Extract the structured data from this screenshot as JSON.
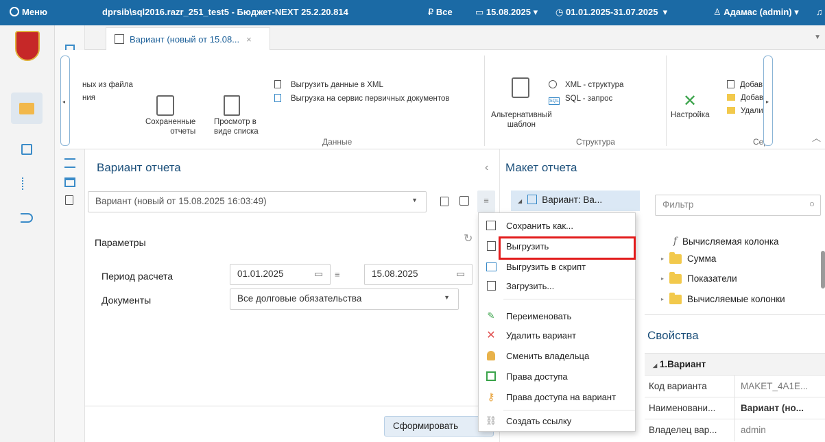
{
  "topbar": {
    "menu_label": "Меню",
    "window_title": "dprsib\\sql2016.razr_251_test5 - Бюджет-NEXT 25.2.20.814",
    "currency_filter": "Все",
    "date": "15.08.2025",
    "period": "01.01.2025-31.07.2025",
    "user": "Адамас (admin)"
  },
  "tabs": {
    "active_label": "Вариант (новый от 15.08..."
  },
  "ribbon": {
    "partial_item_1": "ных из файла",
    "partial_item_2": "ния",
    "saved_reports": "Сохраненные\nотчеты",
    "list_view": "Просмотр в\nвиде списка",
    "export_xml": "Выгрузить данные в XML",
    "export_primary": "Выгрузка на сервис первичных документов",
    "group_data": "Данные",
    "alt_template": "Альтернативный\nшаблон",
    "xml_structure": "XML - структура",
    "sql_query": "SQL - запрос",
    "group_structure": "Структура",
    "settings": "Настройка",
    "add1": "Добав",
    "add2": "Добав",
    "delete": "Удали",
    "group_service": "Серв"
  },
  "report_variant": {
    "title": "Вариант отчета",
    "variant_value": "Вариант (новый от 15.08.2025 16:03:49)",
    "params_label": "Параметры",
    "period_label": "Период расчета",
    "period_from": "01.01.2025",
    "period_to": "15.08.2025",
    "documents_label": "Документы",
    "documents_value": "Все долговые обязательства",
    "generate_button": "Сформировать"
  },
  "context_menu": {
    "items": [
      "Сохранить как...",
      "Выгрузить",
      "Выгрузить в скрипт",
      "Загрузить...",
      "Переименовать",
      "Удалить вариант",
      "Сменить владельца",
      "Права доступа",
      "Права доступа на вариант",
      "Создать ссылку"
    ]
  },
  "report_layout": {
    "title": "Макет отчета",
    "tree_root": "Вариант: Ва...",
    "filter_placeholder": "Фильтр",
    "tree_items": [
      "Вычисляемая колонка",
      "Сумма",
      "Показатели",
      "Вычисляемые колонки"
    ]
  },
  "properties": {
    "title": "Свойства",
    "section": "1.Вариант",
    "rows": [
      {
        "key": "Код варианта",
        "value": "MAKET_4A1E..."
      },
      {
        "key": "Наименовани...",
        "value": "Вариант (но..."
      },
      {
        "key": "Владелец вар...",
        "value": "admin"
      }
    ]
  },
  "colors": {
    "accent": "#1b6aa5",
    "highlight": "#e21b1b"
  }
}
